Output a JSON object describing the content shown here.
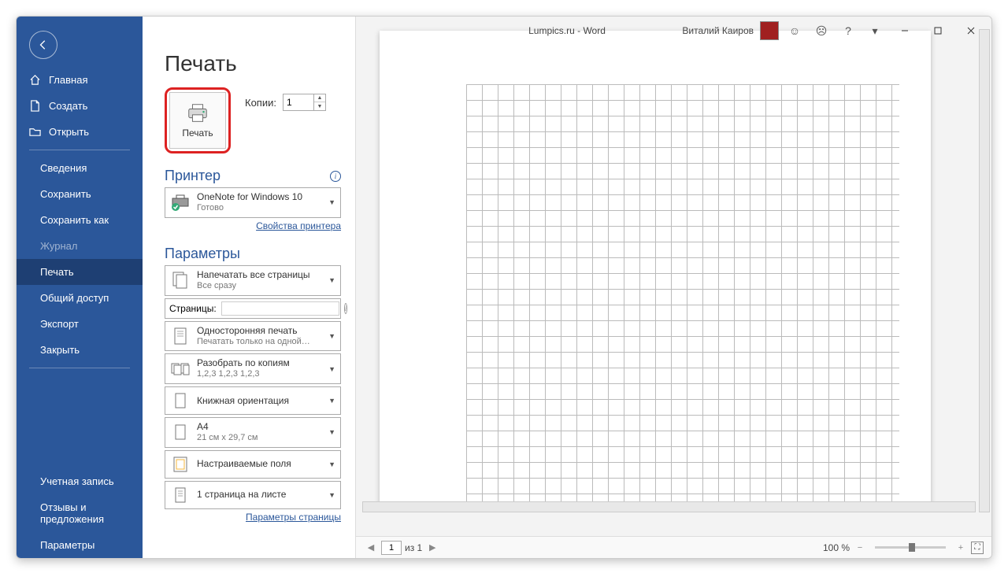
{
  "titlebar": {
    "document": "Lumpics.ru  -  Word",
    "user": "Виталий Каиров"
  },
  "sidebar": {
    "home": "Главная",
    "new": "Создать",
    "open": "Открыть",
    "info": "Сведения",
    "save": "Сохранить",
    "saveas": "Сохранить как",
    "history": "Журнал",
    "print": "Печать",
    "share": "Общий доступ",
    "export": "Экспорт",
    "close": "Закрыть",
    "account": "Учетная запись",
    "feedback": "Отзывы и предложения",
    "options": "Параметры"
  },
  "main": {
    "title": "Печать",
    "print_button": "Печать",
    "copies_label": "Копии:",
    "copies_value": "1",
    "printer_section": "Принтер",
    "printer_name": "OneNote for Windows 10",
    "printer_status": "Готово",
    "printer_props": "Свойства принтера",
    "settings_section": "Параметры",
    "set_range_t": "Напечатать все страницы",
    "set_range_s": "Все сразу",
    "pages_label": "Страницы:",
    "set_sided_t": "Односторонняя печать",
    "set_sided_s": "Печатать только на одной…",
    "set_collate_t": "Разобрать по копиям",
    "set_collate_s": "1,2,3    1,2,3    1,2,3",
    "set_orient": "Книжная ориентация",
    "set_paper_t": "A4",
    "set_paper_s": "21 см x 29,7 см",
    "set_margin": "Настраиваемые поля",
    "set_perpage": "1 страница на листе",
    "page_setup": "Параметры страницы"
  },
  "footer": {
    "page_current": "1",
    "page_of": "из 1",
    "zoom": "100 %"
  }
}
